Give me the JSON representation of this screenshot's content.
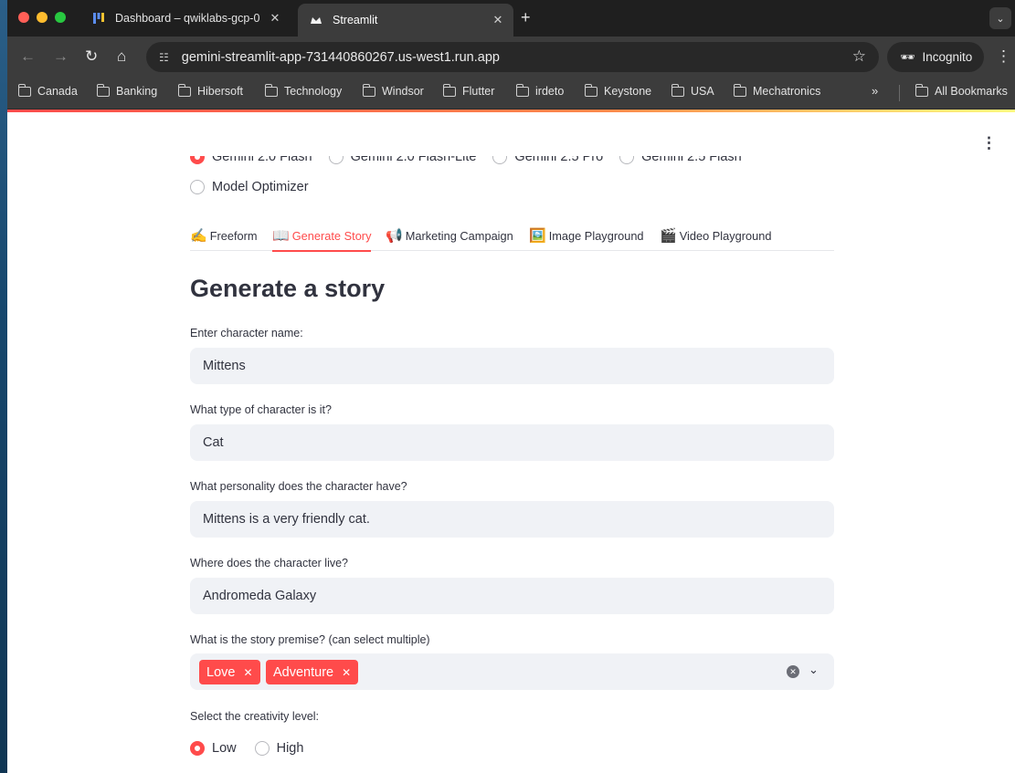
{
  "browser": {
    "tabs": [
      {
        "title": "Dashboard – qwiklabs-gcp-0",
        "icon": "dashboard-icon",
        "active": false
      },
      {
        "title": "Streamlit",
        "icon": "streamlit-crown-icon",
        "active": true
      }
    ],
    "url": "gemini-streamlit-app-731440860267.us-west1.run.app",
    "incognito_label": "Incognito",
    "bookmarks": [
      "Canada",
      "Banking",
      "Hibersoft",
      "Technology",
      "Windsor",
      "Flutter",
      "irdeto",
      "Keystone",
      "USA",
      "Mechatronics"
    ],
    "all_bookmarks_label": "All Bookmarks"
  },
  "app": {
    "model_options": [
      "Gemini 2.0 Flash",
      "Gemini 2.0 Flash-Lite",
      "Gemini 2.5 Pro",
      "Gemini 2.5 Flash"
    ],
    "model_selected": "Gemini 2.0 Flash",
    "model_optimizer_label": "Model Optimizer",
    "tabs": [
      {
        "emoji": "✍️",
        "label": "Freeform"
      },
      {
        "emoji": "📖",
        "label": "Generate Story"
      },
      {
        "emoji": "📢",
        "label": "Marketing Campaign"
      },
      {
        "emoji": "🖼️",
        "label": "Image Playground"
      },
      {
        "emoji": "🎬",
        "label": "Video Playground"
      }
    ],
    "active_tab": "Generate Story",
    "heading": "Generate a story",
    "fields": {
      "name": {
        "label": "Enter character name:",
        "value": "Mittens"
      },
      "type": {
        "label": "What type of character is it?",
        "value": "Cat"
      },
      "personality": {
        "label": "What personality does the character have?",
        "value": "Mittens is a very friendly cat."
      },
      "location": {
        "label": "Where does the character live?",
        "value": "Andromeda Galaxy"
      }
    },
    "premise": {
      "label": "What is the story premise? (can select multiple)",
      "selected": [
        "Love",
        "Adventure"
      ]
    },
    "creativity": {
      "label": "Select the creativity level:",
      "options": [
        "Low",
        "High"
      ],
      "selected": "Low"
    },
    "accent_color": "#ff4b4b"
  }
}
